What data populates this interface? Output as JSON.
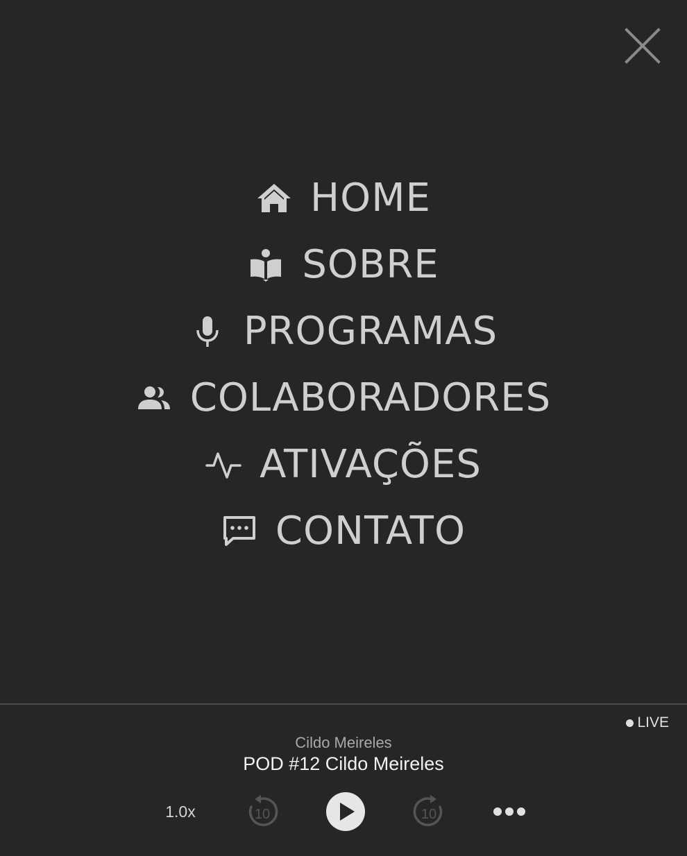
{
  "menu": {
    "items": [
      {
        "label": "HOME",
        "icon": "home-icon"
      },
      {
        "label": "SOBRE",
        "icon": "open-book-icon"
      },
      {
        "label": "PROGRAMAS",
        "icon": "microphone-icon"
      },
      {
        "label": "COLABORADORES",
        "icon": "people-icon"
      },
      {
        "label": "ATIVAÇÕES",
        "icon": "activity-icon"
      },
      {
        "label": "CONTATO",
        "icon": "chat-bubble-icon"
      }
    ]
  },
  "player": {
    "live_label": "LIVE",
    "artist": "Cildo Meireles",
    "track_title": "POD #12 Cildo Meireles",
    "speed_label": "1.0x",
    "skip_back_seconds": "10",
    "skip_forward_seconds": "10"
  },
  "colors": {
    "background": "#262626",
    "menu_text": "#cfcfcf",
    "divider": "#4a4a4a"
  }
}
